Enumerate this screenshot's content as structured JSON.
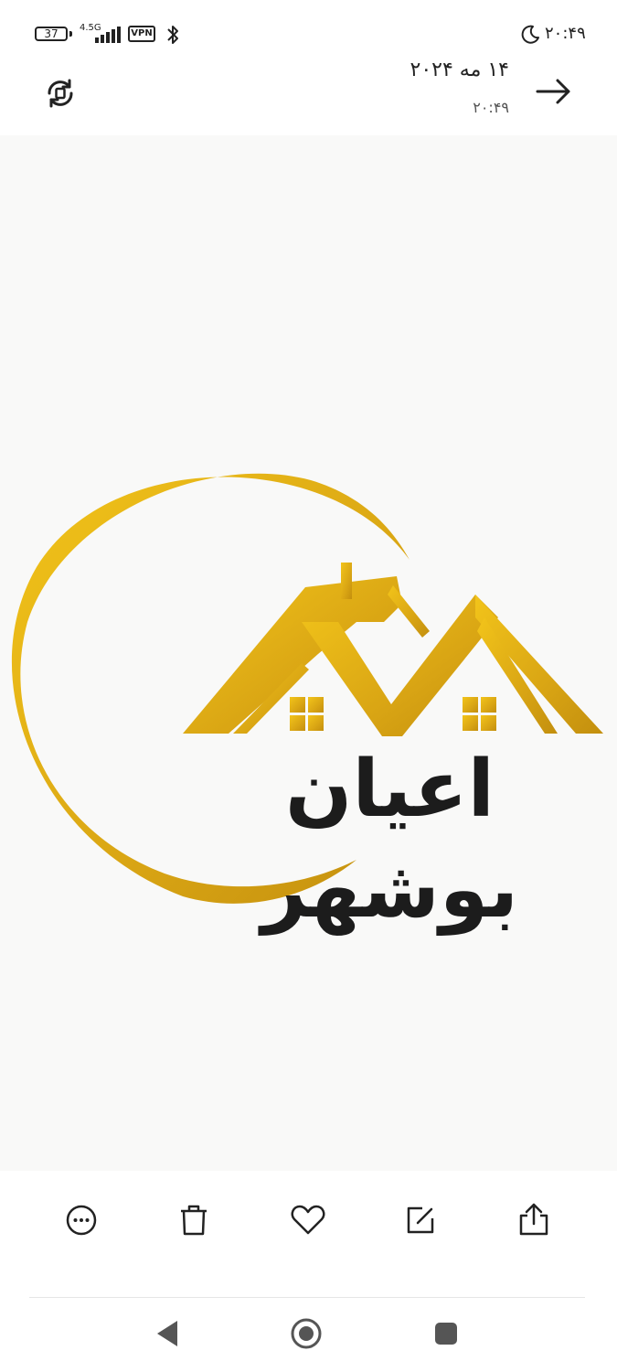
{
  "status_bar": {
    "battery": "37",
    "network_type": "4.5G",
    "vpn_label": "VPN",
    "time": "۲۰:۴۹",
    "icons": [
      "battery-icon",
      "signal-icon",
      "vpn-icon",
      "bluetooth-icon",
      "moon-icon"
    ]
  },
  "header": {
    "date": "۱۴ مه ۲۰۲۴",
    "time": "۲۰:۴۹"
  },
  "image": {
    "logo_text": "اعیان بوشهر",
    "colors": {
      "gold": "#d9a514",
      "gold_light": "#f2c41a",
      "dark": "#1c1c1c",
      "background": "#f9f9f8"
    }
  },
  "toolbar": {
    "icons": [
      "more-icon",
      "delete-icon",
      "favorite-icon",
      "edit-icon",
      "share-icon"
    ]
  },
  "navbar": {
    "icons": [
      "nav-back-icon",
      "nav-home-icon",
      "nav-recents-icon"
    ]
  }
}
